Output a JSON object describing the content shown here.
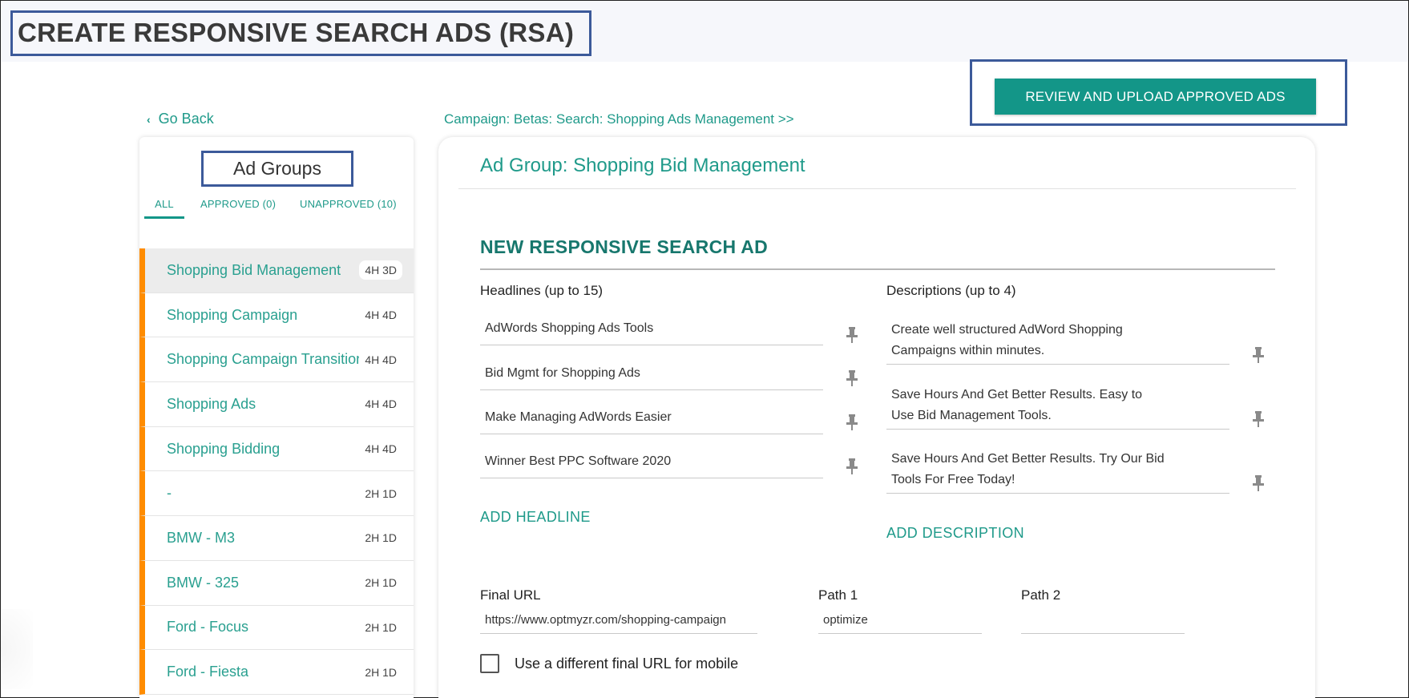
{
  "page": {
    "title": "CREATE RESPONSIVE SEARCH ADS (RSA)",
    "review_button": "REVIEW AND UPLOAD APPROVED ADS",
    "go_back": "Go Back",
    "breadcrumb": "Campaign: Betas: Search: Shopping Ads Management >>"
  },
  "sidebar": {
    "title": "Ad Groups",
    "tabs": [
      {
        "label": "ALL",
        "active": true
      },
      {
        "label": "APPROVED (0)",
        "active": false
      },
      {
        "label": "UNAPPROVED (10)",
        "active": false
      }
    ],
    "items": [
      {
        "name": "Shopping Bid Management",
        "badge": "4H 3D",
        "selected": true
      },
      {
        "name": "Shopping Campaign",
        "badge": "4H 4D"
      },
      {
        "name": "Shopping Campaign Transition",
        "badge": "4H 4D"
      },
      {
        "name": "Shopping Ads",
        "badge": "4H 4D"
      },
      {
        "name": "Shopping Bidding",
        "badge": "4H 4D"
      },
      {
        "name": "-",
        "badge": "2H 1D"
      },
      {
        "name": "BMW - M3",
        "badge": "2H 1D"
      },
      {
        "name": "BMW - 325",
        "badge": "2H 1D"
      },
      {
        "name": "Ford - Focus",
        "badge": "2H 1D"
      },
      {
        "name": "Ford - Fiesta",
        "badge": "2H 1D"
      }
    ]
  },
  "main": {
    "ad_group_heading": "Ad Group: Shopping Bid Management",
    "rsa_title": "NEW RESPONSIVE SEARCH AD",
    "headlines_label": "Headlines (up to 15)",
    "descriptions_label": "Descriptions (up to 4)",
    "headlines": [
      "AdWords Shopping Ads Tools",
      "Bid Mgmt for Shopping Ads",
      "Make Managing AdWords Easier",
      "Winner Best PPC Software 2020"
    ],
    "descriptions": [
      {
        "line1": "Create well structured AdWord Shopping",
        "line2": "Campaigns within minutes."
      },
      {
        "line1": "Save Hours And Get Better Results. Easy to",
        "line2": "Use Bid Management Tools."
      },
      {
        "line1": "Save Hours And Get Better Results. Try Our Bid",
        "line2": "Tools For Free Today!"
      }
    ],
    "add_headline": "ADD HEADLINE",
    "add_description": "ADD DESCRIPTION",
    "final_url_label": "Final URL",
    "final_url_value": "https://www.optmyzr.com/shopping-campaign",
    "path1_label": "Path 1",
    "path1_value": "optimize",
    "path2_label": "Path 2",
    "path2_value": "",
    "mobile_checkbox_label": "Use a different final URL for mobile",
    "mobile_checkbox_checked": false
  },
  "colors": {
    "accent": "#139688",
    "link": "#1f9a8a",
    "indicator": "#ff8c00",
    "annotation_box": "#3c5a9a"
  }
}
